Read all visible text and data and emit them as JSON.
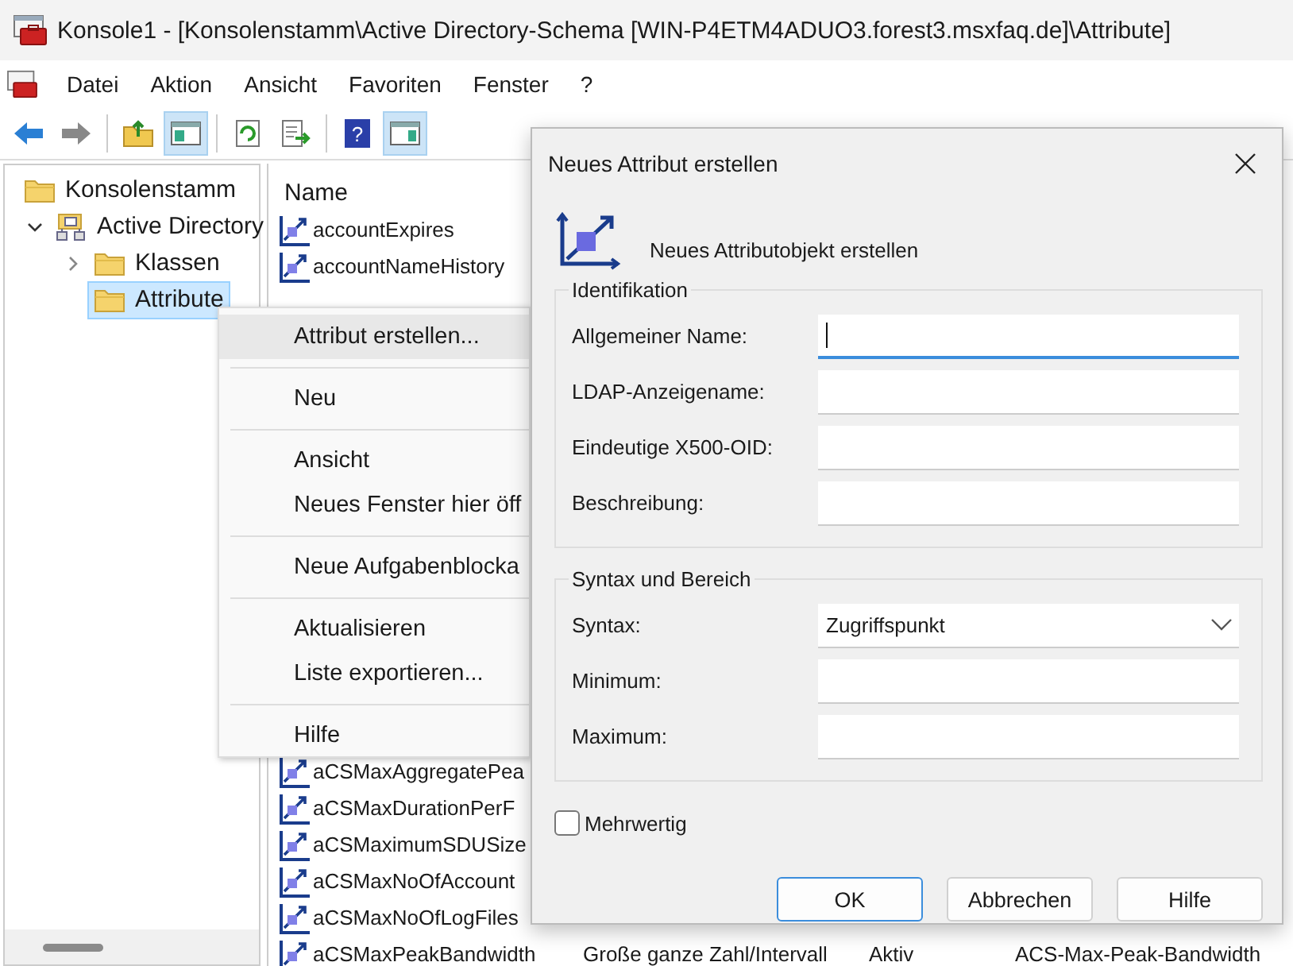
{
  "window": {
    "title": "Konsole1 - [Konsolenstamm\\Active Directory-Schema [WIN-P4ETM4ADUO3.forest3.msxfaq.de]\\Attribute]"
  },
  "menu": [
    "Datei",
    "Aktion",
    "Ansicht",
    "Favoriten",
    "Fenster",
    "?"
  ],
  "toolbar": [
    {
      "kind": "back",
      "pressed": false
    },
    {
      "kind": "forward",
      "pressed": false
    },
    {
      "kind": "separator"
    },
    {
      "kind": "folder-up",
      "pressed": false
    },
    {
      "kind": "tree-pane",
      "pressed": true
    },
    {
      "kind": "separator"
    },
    {
      "kind": "refresh",
      "pressed": false
    },
    {
      "kind": "export",
      "pressed": false
    },
    {
      "kind": "separator"
    },
    {
      "kind": "help",
      "pressed": false,
      "label": "?"
    },
    {
      "kind": "action-pane",
      "pressed": true
    }
  ],
  "tree": [
    {
      "label": "Konsolenstamm",
      "kind": "folder",
      "selected": false,
      "children": [
        {
          "label": "Active Directory",
          "kind": "schema",
          "selected": false,
          "expanded": true,
          "children": [
            {
              "label": "Klassen",
              "kind": "folder",
              "selected": false,
              "expanded": false
            },
            {
              "label": "Attribute",
              "kind": "folder",
              "selected": true
            }
          ]
        }
      ]
    }
  ],
  "list": {
    "header": "Name",
    "rows_top": [
      {
        "name": "accountExpires"
      },
      {
        "name": "accountNameHistory"
      }
    ],
    "rows_bottom": [
      {
        "name": "aCSMaxAggregatePea"
      },
      {
        "name": "aCSMaxDurationPerF"
      },
      {
        "name": "aCSMaximumSDUSize"
      },
      {
        "name": "aCSMaxNoOfAccount"
      },
      {
        "name": "aCSMaxNoOfLogFiles"
      },
      {
        "name": "aCSMaxPeakBandwidth",
        "column_2": "Große ganze Zahl/Intervall",
        "column_3": "Aktiv",
        "column_4": "ACS-Max-Peak-Bandwidth"
      }
    ]
  },
  "context_menu": [
    {
      "kind": "item",
      "label": "Attribut erstellen...",
      "selected": true
    },
    {
      "kind": "separator"
    },
    {
      "kind": "item",
      "label": "Neu",
      "selected": false
    },
    {
      "kind": "separator"
    },
    {
      "kind": "item",
      "label": "Ansicht",
      "selected": false
    },
    {
      "kind": "item",
      "label": "Neues Fenster hier öff",
      "selected": false
    },
    {
      "kind": "separator"
    },
    {
      "kind": "item",
      "label": "Neue Aufgabenblocka",
      "selected": false
    },
    {
      "kind": "separator"
    },
    {
      "kind": "item",
      "label": "Aktualisieren",
      "selected": false
    },
    {
      "kind": "item",
      "label": "Liste exportieren...",
      "selected": false
    },
    {
      "kind": "separator"
    },
    {
      "kind": "item",
      "label": "Hilfe",
      "selected": false
    }
  ],
  "dialog": {
    "title": "Neues Attribut erstellen",
    "heading": "Neues Attributobjekt erstellen",
    "groups": [
      {
        "title": "Identifikation",
        "fields": [
          {
            "kind": "text",
            "label": "Allgemeiner Name:",
            "focused": true
          },
          {
            "kind": "text",
            "label": "LDAP-Anzeigename:",
            "focused": false
          },
          {
            "kind": "text",
            "label": "Eindeutige X500-OID:",
            "focused": false
          },
          {
            "kind": "text",
            "label": "Beschreibung:",
            "focused": false
          }
        ]
      },
      {
        "title": "Syntax und Bereich",
        "fields": [
          {
            "kind": "dropdown",
            "label": "Syntax:",
            "value": "Zugriffspunkt"
          },
          {
            "kind": "text",
            "label": "Minimum:",
            "focused": false
          },
          {
            "kind": "text",
            "label": "Maximum:",
            "focused": false
          }
        ]
      }
    ],
    "checkbox": {
      "label": "Mehrwertig",
      "checked": false
    },
    "buttons": [
      {
        "label": "OK",
        "default": true
      },
      {
        "label": "Abbrechen",
        "default": false
      },
      {
        "label": "Hilfe",
        "default": false
      }
    ]
  }
}
